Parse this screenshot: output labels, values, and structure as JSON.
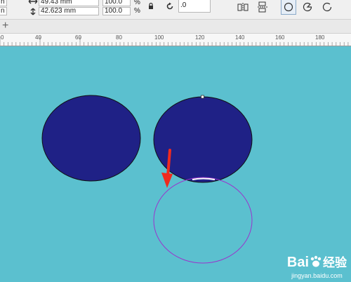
{
  "toolbar": {
    "unit_partial_1": "n",
    "unit_partial_2": "n",
    "width_value": "49.43 mm",
    "height_value": "42.623 mm",
    "scale_x": "100.0",
    "scale_y": "100.0",
    "percent_1": "%",
    "percent_2": "%",
    "rotation_value": ".0",
    "icons": [
      "width-arrows-icon",
      "height-arrows-icon",
      "lock-icon",
      "rotate-icon",
      "mirror-horizontal-icon",
      "mirror-vertical-icon",
      "ellipse-icon",
      "pie-icon",
      "arc-icon"
    ]
  },
  "tabbar": {
    "add_label": "+"
  },
  "ruler": {
    "labels": [
      "0",
      "40",
      "60",
      "80",
      "100",
      "120",
      "140",
      "160",
      "180"
    ]
  },
  "canvas": {
    "background": "#5bc0cf",
    "fill_color": "#1f2186",
    "outline_color": "#9b33cc",
    "arrow_color": "#f02a1e"
  },
  "watermark": {
    "brand": "Bai",
    "brand_suffix": "经验",
    "url": "jingyan.baidu.com"
  }
}
